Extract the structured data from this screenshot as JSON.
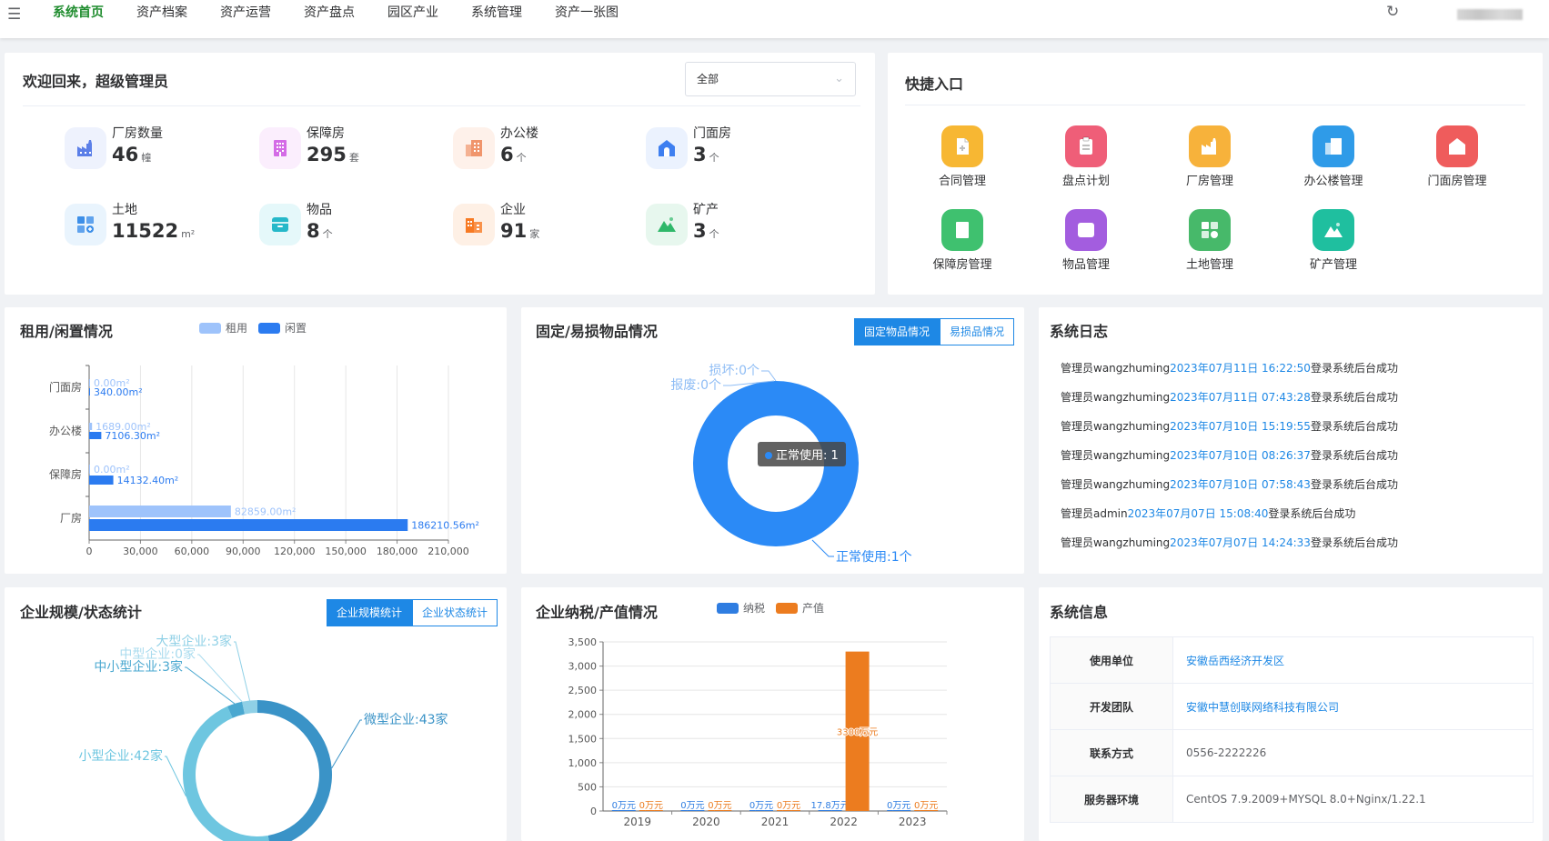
{
  "nav": {
    "items": [
      "系统首页",
      "资产档案",
      "资产运营",
      "资产盘点",
      "园区产业",
      "系统管理",
      "资产一张图"
    ],
    "active": 0
  },
  "welcome": {
    "title": "欢迎回来，超级管理员",
    "select_value": "全部",
    "stats": [
      {
        "label": "厂房数量",
        "value": "46",
        "unit": "幢",
        "icon": "factory-icon",
        "color": "#5b7fe8",
        "bg": "#eef2fd"
      },
      {
        "label": "保障房",
        "value": "295",
        "unit": "套",
        "icon": "building-icon",
        "color": "#d46be6",
        "bg": "#fbeefd"
      },
      {
        "label": "办公楼",
        "value": "6",
        "unit": "个",
        "icon": "office-icon",
        "color": "#f0956c",
        "bg": "#fef1ea"
      },
      {
        "label": "门面房",
        "value": "3",
        "unit": "个",
        "icon": "shop-icon",
        "color": "#3e7ff0",
        "bg": "#ebf2fe"
      },
      {
        "label": "土地",
        "value": "11522",
        "unit": "m²",
        "icon": "land-icon",
        "color": "#3d8fe8",
        "bg": "#e9f4fd"
      },
      {
        "label": "物品",
        "value": "8",
        "unit": "个",
        "icon": "box-icon",
        "color": "#26b8c9",
        "bg": "#e5f8fa"
      },
      {
        "label": "企业",
        "value": "91",
        "unit": "家",
        "icon": "enterprise-icon",
        "color": "#f77a23",
        "bg": "#fef0e5"
      },
      {
        "label": "矿产",
        "value": "3",
        "unit": "个",
        "icon": "mountain-icon",
        "color": "#2fb86a",
        "bg": "#e7f7ee"
      }
    ]
  },
  "quick": {
    "title": "快捷入口",
    "items": [
      {
        "label": "合同管理",
        "icon": "contract-icon",
        "color": "#f7b733"
      },
      {
        "label": "盘点计划",
        "icon": "plan-icon",
        "color": "#ef5e78"
      },
      {
        "label": "厂房管理",
        "icon": "factory-icon",
        "color": "#f7b23b"
      },
      {
        "label": "办公楼管理",
        "icon": "office-icon",
        "color": "#2f9be8"
      },
      {
        "label": "门面房管理",
        "icon": "shop-icon",
        "color": "#ef5c5c"
      },
      {
        "label": "保障房管理",
        "icon": "building-icon",
        "color": "#3fc16f"
      },
      {
        "label": "物品管理",
        "icon": "box-icon",
        "color": "#a35ddf"
      },
      {
        "label": "土地管理",
        "icon": "land-icon",
        "color": "#47b96a"
      },
      {
        "label": "矿产管理",
        "icon": "mountain-icon",
        "color": "#1fbf9f"
      }
    ]
  },
  "rent": {
    "title": "租用/闲置情况",
    "legend": [
      "租用",
      "闲置"
    ]
  },
  "fixed": {
    "title": "固定/易损物品情况",
    "tabs": [
      "固定物品情况",
      "易损品情况"
    ],
    "tooltip": "正常使用: 1"
  },
  "syslog": {
    "title": "系统日志",
    "lines": [
      {
        "pre": "管理员wangzhuming",
        "ts": "2023年07月11日 16:22:50",
        "post": "登录系统后台成功"
      },
      {
        "pre": "管理员wangzhuming",
        "ts": "2023年07月11日 07:43:28",
        "post": "登录系统后台成功"
      },
      {
        "pre": "管理员wangzhuming",
        "ts": "2023年07月10日 15:19:55",
        "post": "登录系统后台成功"
      },
      {
        "pre": "管理员wangzhuming",
        "ts": "2023年07月10日 08:26:37",
        "post": "登录系统后台成功"
      },
      {
        "pre": "管理员wangzhuming",
        "ts": "2023年07月10日 07:58:43",
        "post": "登录系统后台成功"
      },
      {
        "pre": "管理员admin",
        "ts": "2023年07月07日 15:08:40",
        "post": "登录系统后台成功"
      },
      {
        "pre": "管理员wangzhuming",
        "ts": "2023年07月07日 14:24:33",
        "post": "登录系统后台成功"
      }
    ]
  },
  "scale": {
    "title": "企业规模/状态统计",
    "tabs": [
      "企业规模统计",
      "企业状态统计"
    ]
  },
  "tax": {
    "title": "企业纳税/产值情况",
    "legend": [
      "纳税",
      "产值"
    ]
  },
  "sysinfo": {
    "title": "系统信息",
    "rows": [
      {
        "k": "使用单位",
        "v": "安徽岳西经济开发区"
      },
      {
        "k": "开发团队",
        "v": "安徽中慧创联网络科技有限公司"
      },
      {
        "k": "联系方式",
        "v": "0556-2222226"
      },
      {
        "k": "服务器环境",
        "v": "CentOS 7.9.2009+MYSQL 8.0+Nginx/1.22.1"
      }
    ]
  },
  "chart_data": [
    {
      "type": "bar",
      "orientation": "horizontal",
      "categories": [
        "门面房",
        "办公楼",
        "保障房",
        "厂房"
      ],
      "series": [
        {
          "name": "租用",
          "values": [
            0.0,
            1689.0,
            0.0,
            82859.0
          ],
          "labels": [
            "0.00m²",
            "1689.00m²",
            "0.00m²",
            "82859.00m²"
          ],
          "color": "#9ec3fb"
        },
        {
          "name": "闲置",
          "values": [
            340.0,
            7106.3,
            14132.4,
            186210.56
          ],
          "labels": [
            "340.00m²",
            "7106.30m²",
            "14132.40m²",
            "186210.56m²"
          ],
          "color": "#2b7bf0"
        }
      ],
      "xlim": [
        0,
        210000
      ],
      "xticks": [
        "0",
        "30,000",
        "60,000",
        "90,000",
        "120,000",
        "150,000",
        "180,000",
        "210,000"
      ],
      "grid": true
    },
    {
      "type": "pie",
      "donut": true,
      "categories": [
        "正常使用",
        "损坏",
        "报废"
      ],
      "values": [
        1,
        0,
        0
      ],
      "labels": [
        "正常使用:1个",
        "损坏:0个",
        "报废:0个"
      ],
      "colors": [
        "#2b8af6",
        "#2b8af6",
        "#2b8af6"
      ]
    },
    {
      "type": "pie",
      "donut": true,
      "categories": [
        "微型企业",
        "小型企业",
        "中小型企业",
        "中型企业",
        "大型企业"
      ],
      "values": [
        43,
        42,
        3,
        0,
        3
      ],
      "labels": [
        "微型企业:43家",
        "小型企业:42家",
        "中小型企业:3家",
        "中型企业:0家",
        "大型企业:3家"
      ],
      "colors": [
        "#3a93c7",
        "#6ec6e0",
        "#4aa8d0",
        "#a9dbee",
        "#8fd0e6"
      ]
    },
    {
      "type": "bar",
      "categories": [
        "2019",
        "2020",
        "2021",
        "2022",
        "2023"
      ],
      "series": [
        {
          "name": "纳税",
          "values": [
            0,
            0,
            0,
            17.8,
            0
          ],
          "labels": [
            "0万元",
            "0万元",
            "0万元",
            "17.8万元",
            "0万元"
          ],
          "color": "#2f7de1"
        },
        {
          "name": "产值",
          "values": [
            0,
            0,
            0,
            3300,
            0
          ],
          "labels": [
            "0万元",
            "0万元",
            "0万元",
            "3300万元",
            "0万元"
          ],
          "color": "#ec7c1f"
        }
      ],
      "ylim": [
        0,
        3500
      ],
      "yticks": [
        "0",
        "500",
        "1,000",
        "1,500",
        "2,000",
        "2,500",
        "3,000",
        "3,500"
      ],
      "grid": true
    }
  ]
}
